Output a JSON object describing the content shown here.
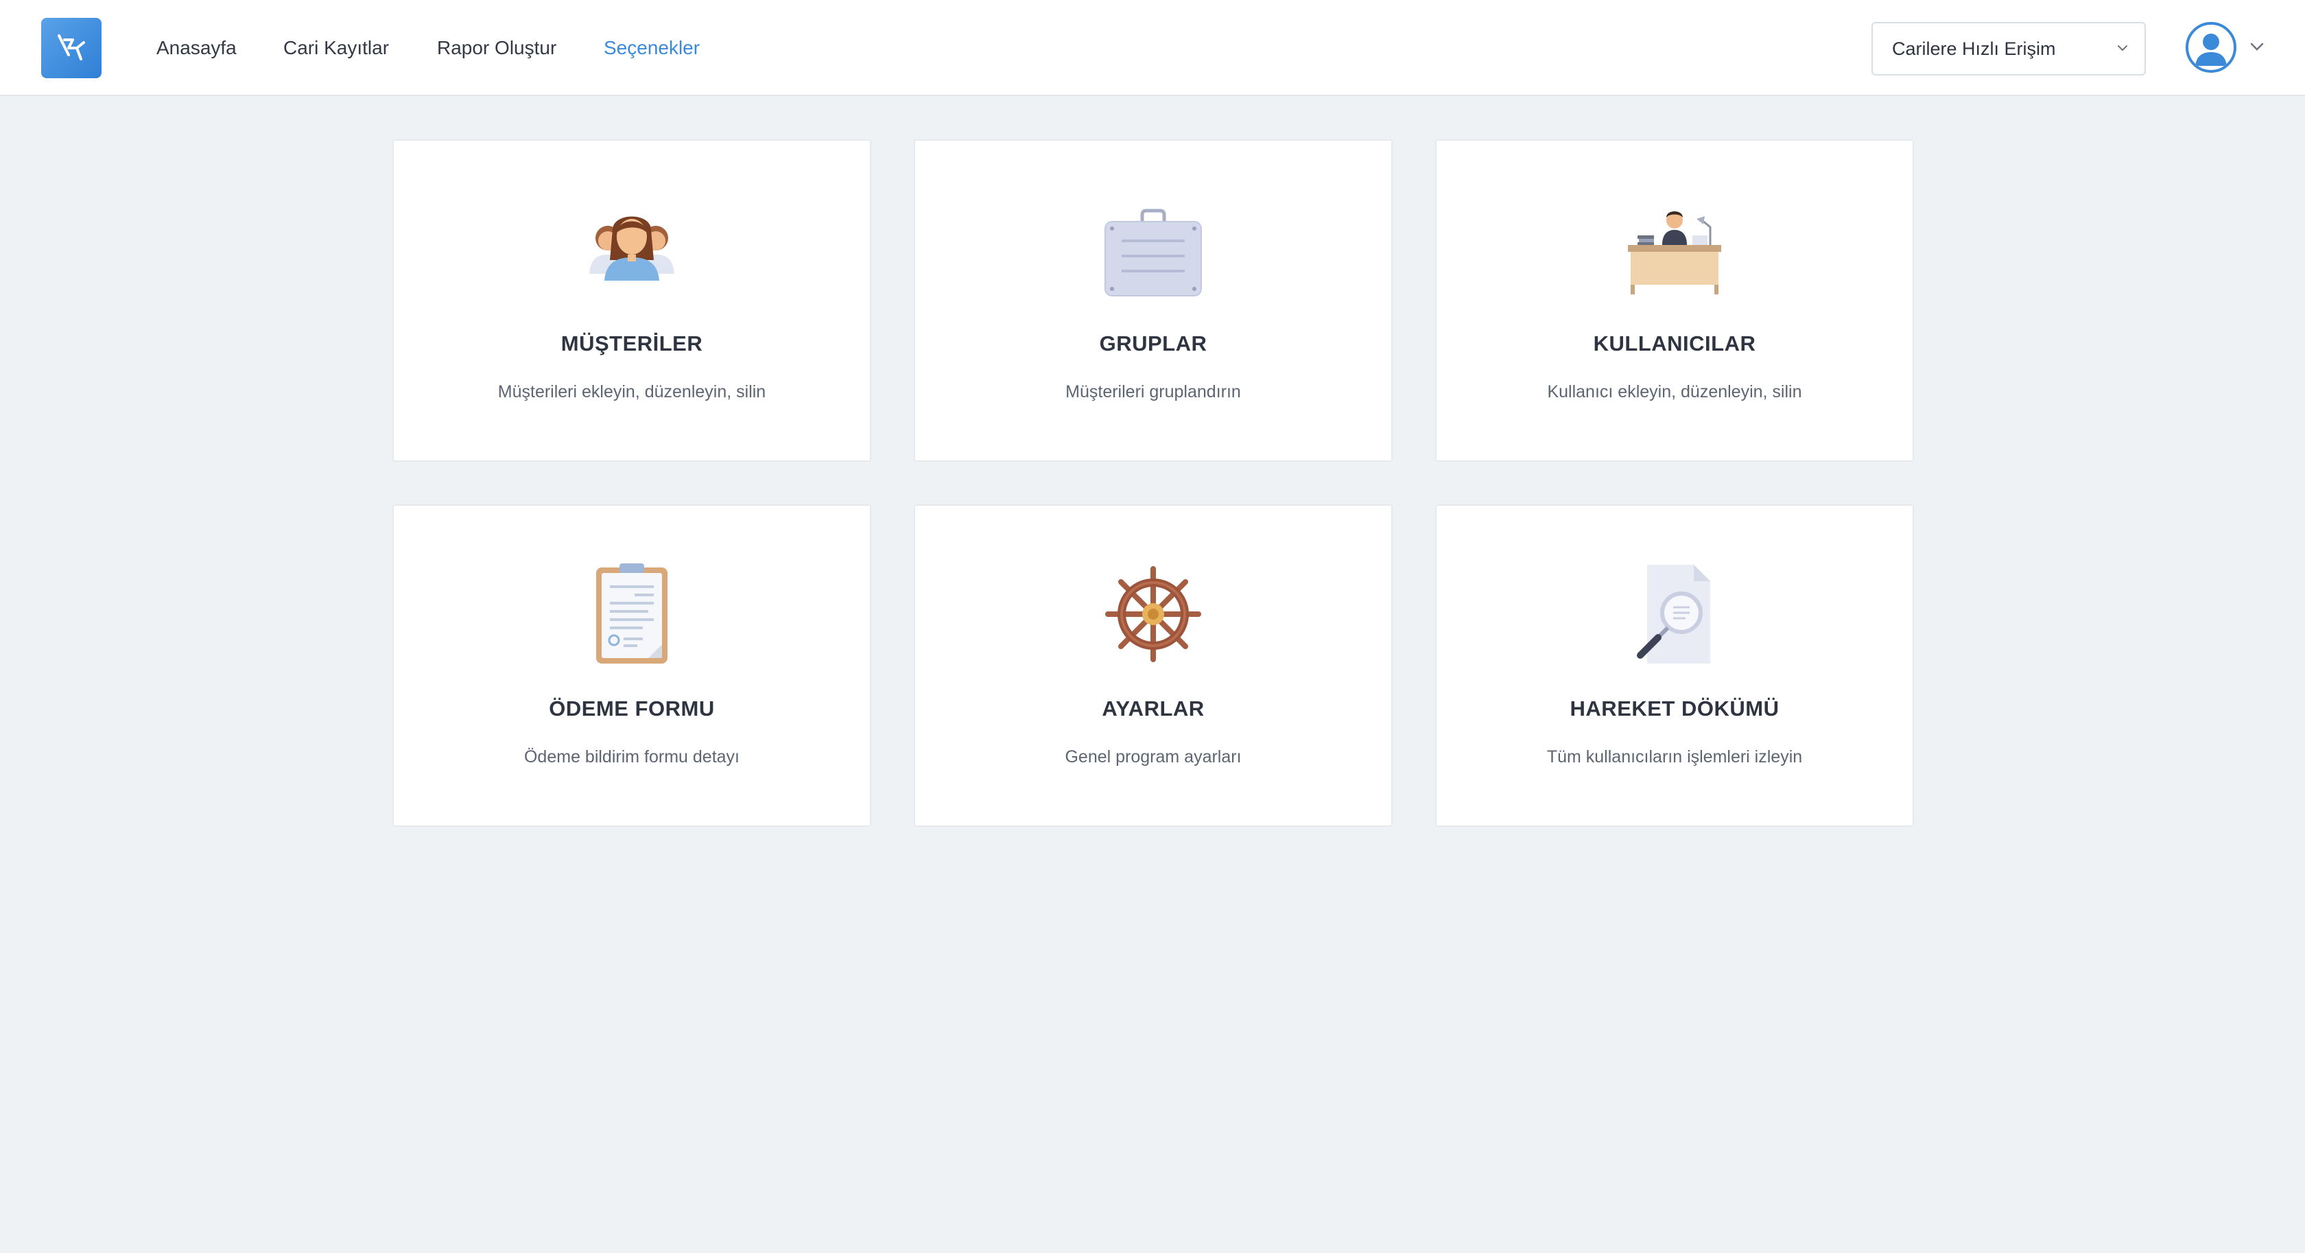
{
  "nav": {
    "logo": "logo",
    "links": [
      {
        "label": "Anasayfa",
        "active": false
      },
      {
        "label": "Cari Kayıtlar",
        "active": false
      },
      {
        "label": "Rapor Oluştur",
        "active": false
      },
      {
        "label": "Seçenekler",
        "active": true
      }
    ],
    "quick_access": {
      "selected": "Carilere Hızlı Erişim",
      "icon": "chevron-down-icon"
    },
    "user": {
      "icon": "user-avatar-icon",
      "menu_icon": "chevron-down-icon"
    }
  },
  "cards": [
    {
      "title": "MÜŞTERİLER",
      "description": "Müşterileri ekleyin, düzenleyin, silin",
      "icon": "customers-icon"
    },
    {
      "title": "GRUPLAR",
      "description": "Müşterileri gruplandırın",
      "icon": "briefcase-icon"
    },
    {
      "title": "KULLANICILAR",
      "description": "Kullanıcı ekleyin, düzenleyin, silin",
      "icon": "office-desk-icon"
    },
    {
      "title": "ÖDEME FORMU",
      "description": "Ödeme bildirim formu detayı",
      "icon": "clipboard-icon"
    },
    {
      "title": "AYARLAR",
      "description": "Genel program ayarları",
      "icon": "ship-wheel-icon"
    },
    {
      "title": "HAREKET DÖKÜMÜ",
      "description": "Tüm kullanıcıların işlemleri izleyin",
      "icon": "document-search-icon"
    }
  ],
  "colors": {
    "accent": "#3b8ad9",
    "background": "#eff2f5",
    "card": "#ffffff",
    "text": "#2f3441",
    "muted": "#5d6572"
  }
}
